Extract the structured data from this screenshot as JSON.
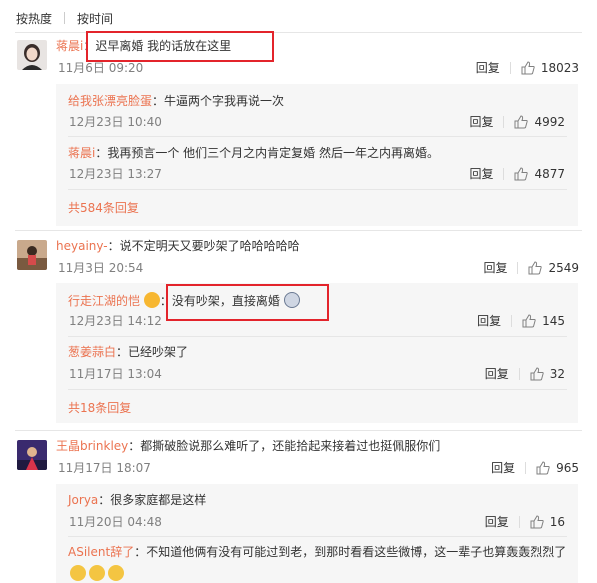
{
  "sort": {
    "hot": "按热度",
    "time": "按时间"
  },
  "ui": {
    "reply": "回复"
  },
  "colors": {
    "username": "#eb7350",
    "highlight_box": "#e3242b",
    "subreply_bg": "#f6f6f6"
  },
  "comments": [
    {
      "user": "蒋晨i",
      "text": "：迟早离婚 我的话放在这里",
      "time": "11月6日 09:20",
      "likes": "18023",
      "replies": [
        {
          "user": "给我张漂亮脸蛋",
          "text": "：牛逼两个字我再说一次",
          "time": "12月23日 10:40",
          "likes": "4992"
        },
        {
          "user": "蒋晨i",
          "text": "：我再预言一个 他们三个月之内肯定复婚 然后一年之内再离婚。",
          "time": "12月23日 13:27",
          "likes": "4877"
        }
      ],
      "more": "共584条回复"
    },
    {
      "user": "heyainy-",
      "text": "：说不定明天又要吵架了哈哈哈哈哈",
      "time": "11月3日 20:54",
      "likes": "2549",
      "replies": [
        {
          "user": "行走江湖的恺",
          "text": "：没有吵架，直接离婚",
          "time": "12月23日 14:12",
          "likes": "145"
        },
        {
          "user": "葱姜蒜白",
          "text": "：已经吵架了",
          "time": "11月17日 13:04",
          "likes": "32"
        }
      ],
      "more": "共18条回复"
    },
    {
      "user": "王晶brinkley",
      "text": "：都撕破脸说那么难听了，还能拾起来接着过也挺佩服你们",
      "time": "11月17日 18:07",
      "likes": "965",
      "replies": [
        {
          "user": "Jorya",
          "text": "：很多家庭都是这样",
          "time": "11月20日 04:48",
          "likes": "16"
        },
        {
          "user": "ASilent辞了",
          "text": "：不知道他俩有没有可能过到老，到那时看看这些微博，这一辈子也算轰轰烈烈了"
        }
      ]
    }
  ]
}
